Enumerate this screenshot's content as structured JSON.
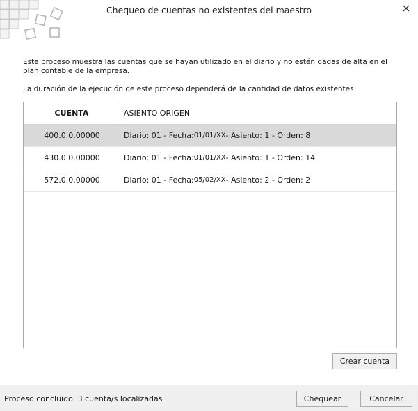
{
  "window": {
    "title": "Chequeo de cuentas no existentes del maestro"
  },
  "description": {
    "line1": "Este proceso muestra las cuentas que se hayan utilizado en el diario y no estén dadas de alta en el plan contable de la empresa.",
    "line2": "La duración de la ejecución de este proceso dependerá de la cantidad de datos existentes."
  },
  "grid": {
    "columns": {
      "cuenta": "CUENTA",
      "asiento": "ASIENTO ORIGEN"
    },
    "rows": [
      {
        "cuenta": "400.0.0.00000",
        "diario_label": "Diario: 01 - Fecha: ",
        "fecha": "01/01/XX",
        "rest": " - Asiento: 1 - Orden: 8",
        "selected": true
      },
      {
        "cuenta": "430.0.0.00000",
        "diario_label": "Diario: 01 - Fecha: ",
        "fecha": "01/01/XX",
        "rest": " - Asiento: 1 - Orden: 14",
        "selected": false
      },
      {
        "cuenta": "572.0.0.00000",
        "diario_label": "Diario: 01 - Fecha: ",
        "fecha": "05/02/XX",
        "rest": " - Asiento: 2 - Orden: 2",
        "selected": false
      }
    ]
  },
  "buttons": {
    "crear_cuenta": "Crear cuenta",
    "chequear": "Chequear",
    "cancelar": "Cancelar"
  },
  "status": {
    "text": "Proceso concluido. 3 cuenta/s localizadas"
  },
  "colors": {
    "selected_row": "#d9d9d9",
    "footer_bg": "#f0f0f0",
    "logo_stroke": "#b5b5b5"
  }
}
